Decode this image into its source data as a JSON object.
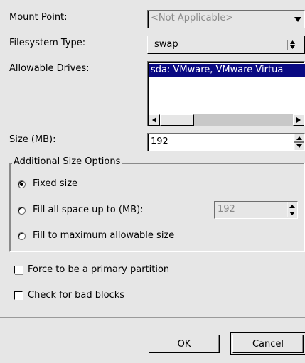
{
  "mount_point": {
    "label": "Mount Point:",
    "value": "<Not Applicable>"
  },
  "filesystem_type": {
    "label": "Filesystem Type:",
    "value": "swap"
  },
  "allowable_drives": {
    "label": "Allowable Drives:",
    "items": [
      "sda: VMware, VMware Virtua"
    ]
  },
  "size": {
    "label": "Size (MB):",
    "value": "192"
  },
  "additional": {
    "legend": "Additional Size Options",
    "fixed_label": "Fixed size",
    "fill_upto_label": "Fill all space up to (MB):",
    "fill_upto_value": "192",
    "fill_max_label": "Fill to maximum allowable size"
  },
  "force_primary_label": "Force to be a primary partition",
  "check_bad_blocks_label": "Check for bad blocks",
  "buttons": {
    "ok": "OK",
    "cancel": "Cancel"
  },
  "colors": {
    "selection": "#0a0a82",
    "background": "#e6e6e6"
  }
}
